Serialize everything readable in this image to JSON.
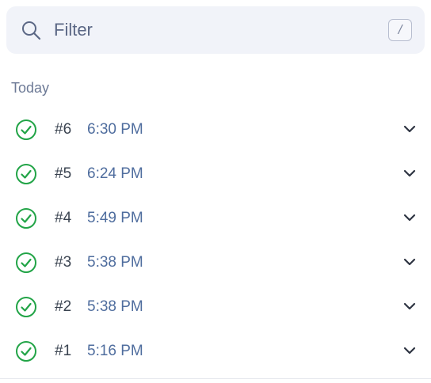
{
  "filter": {
    "placeholder": "Filter",
    "shortcut_key": "/"
  },
  "section": {
    "label": "Today"
  },
  "runs": [
    {
      "number": "#6",
      "time": "6:30 PM",
      "status": "success"
    },
    {
      "number": "#5",
      "time": "6:24 PM",
      "status": "success"
    },
    {
      "number": "#4",
      "time": "5:49 PM",
      "status": "success"
    },
    {
      "number": "#3",
      "time": "5:38 PM",
      "status": "success"
    },
    {
      "number": "#2",
      "time": "5:38 PM",
      "status": "success"
    },
    {
      "number": "#1",
      "time": "5:16 PM",
      "status": "success"
    }
  ],
  "colors": {
    "success": "#22a447",
    "time_text": "#4f6d9e",
    "filter_bg": "#f1f3f9"
  },
  "icons": {
    "search": "search-icon",
    "status": "check-circle-icon",
    "expand": "chevron-down-icon"
  }
}
